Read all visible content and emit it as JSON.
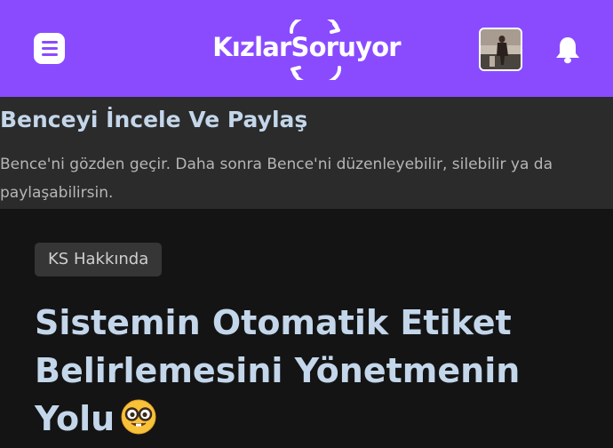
{
  "header": {
    "logo_text": "KızlarSoruyor",
    "brand_color": "#8a4bff",
    "menu_icon": "menu-icon",
    "avatar_alt": "profile photo",
    "notification_icon": "bell-icon"
  },
  "banner": {
    "title": "Benceyi İncele Ve Paylaş",
    "description": "Bence'ni gözden geçir. Daha sonra Bence'ni düzenleyebilir, silebilir ya da paylaşabilirsin."
  },
  "post": {
    "category": "KS Hakkında",
    "title": "Sistemin Otomatik Etiket Belirlemesini Yönetmenin Yolu",
    "title_emoji": "nerd-face-emoji"
  }
}
